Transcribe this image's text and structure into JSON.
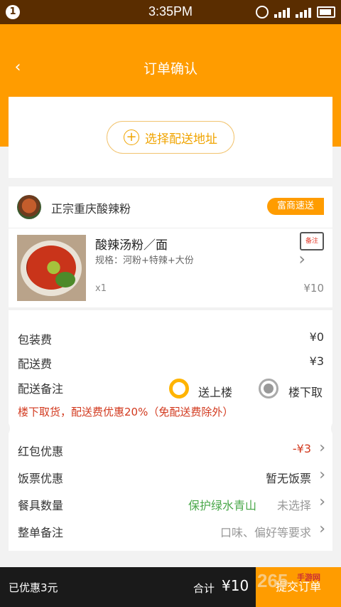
{
  "status_bar": {
    "notif": "1",
    "time": "3:35PM",
    "net": "4G"
  },
  "header": {
    "title": "订单确认"
  },
  "address": {
    "button_label": "选择配送地址"
  },
  "shop": {
    "name": "正宗重庆酸辣粉",
    "tag": "富商速送"
  },
  "item": {
    "name": "酸辣汤粉／面",
    "spec": "规格：河粉+特辣+大份",
    "qty": "x1",
    "price": "¥10",
    "note_icon_label": "备注"
  },
  "fees": {
    "packaging_label": "包装费",
    "packaging_value": "¥0",
    "delivery_label": "配送费",
    "delivery_value": "¥3",
    "delivery_note_label": "配送备注",
    "option_upstairs": "送上楼",
    "option_downstairs": "楼下取",
    "selected_option": "送上楼",
    "promo_text": "楼下取货，配送费优惠20%（免配送费除外）"
  },
  "discounts": {
    "redpacket_label": "红包优惠",
    "redpacket_value": "-¥3",
    "voucher_label": "饭票优惠",
    "voucher_value": "暂无饭票",
    "utensils_label": "餐具数量",
    "utensils_hint": "保护绿水青山",
    "utensils_value": "未选择",
    "remark_label": "整单备注",
    "remark_value": "口味、偏好等要求"
  },
  "bottom": {
    "discount": "已优惠3元",
    "total_label": "合计",
    "total_value": "¥10",
    "submit": "提交订单"
  },
  "watermark": {
    "logo": "265",
    "text": "手游网"
  },
  "colors": {
    "accent": "#ff9c00",
    "promo": "#d23a1f",
    "green_hint": "#4aa84a",
    "status_bar": "#5a2d00"
  }
}
